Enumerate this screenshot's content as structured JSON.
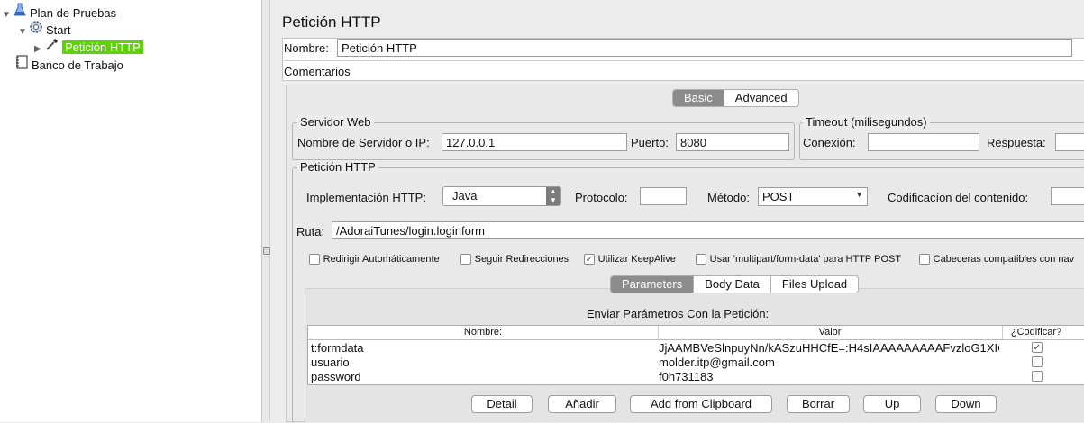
{
  "tree": {
    "items": [
      {
        "label": "Plan de Pruebas",
        "icon": "flask-icon"
      },
      {
        "label": "Start",
        "icon": "gear-icon"
      },
      {
        "label": "Petición HTTP",
        "icon": "pipette-icon"
      },
      {
        "label": "Banco de Trabajo",
        "icon": "notebook-icon"
      }
    ]
  },
  "panel": {
    "title": "Petición HTTP",
    "name_label": "Nombre:",
    "name_value": "Petición HTTP",
    "comments_label": "Comentarios",
    "tabs": [
      "Basic",
      "Advanced"
    ]
  },
  "server": {
    "legend": "Servidor Web",
    "host_label": "Nombre de Servidor o IP:",
    "host_value": "127.0.0.1",
    "port_label": "Puerto:",
    "port_value": "8080"
  },
  "timeout": {
    "legend": "Timeout (milisegundos)",
    "connect_label": "Conexión:",
    "response_label": "Respuesta:"
  },
  "request": {
    "legend": "Petición HTTP",
    "impl_label": "Implementación HTTP:",
    "impl_value": "Java",
    "protocol_label": "Protocolo:",
    "method_label": "Método:",
    "method_value": "POST",
    "encoding_label": "Codificacíon del contenido:",
    "path_label": "Ruta:",
    "path_value": "/AdoraiTunes/login.loginform",
    "options": [
      {
        "label": "Redirigir Automáticamente",
        "checked": false
      },
      {
        "label": "Seguir Redirecciones",
        "checked": false
      },
      {
        "label": "Utilizar KeepAlive",
        "checked": true
      },
      {
        "label": "Usar 'multipart/form-data' para HTTP POST",
        "checked": false
      },
      {
        "label": "Cabeceras compatibles con nav",
        "checked": false
      }
    ]
  },
  "params": {
    "tabs": [
      "Parameters",
      "Body Data",
      "Files Upload"
    ],
    "table_title": "Enviar Parámetros Con la Petición:",
    "columns": [
      "Nombre:",
      "Valor",
      "¿Codificar?"
    ],
    "rows": [
      {
        "name": "t:formdata",
        "value": "JjAAMBVeSlnpuyNn/kASzuHHCfE=:H4sIAAAAAAAAAFvzloG1XIC...",
        "encode": true
      },
      {
        "name": "usuario",
        "value": "molder.itp@gmail.com",
        "encode": false
      },
      {
        "name": "password",
        "value": "f0h731183",
        "encode": false
      }
    ],
    "buttons": [
      "Detail",
      "Añadir",
      "Add from Clipboard",
      "Borrar",
      "Up",
      "Down"
    ]
  }
}
